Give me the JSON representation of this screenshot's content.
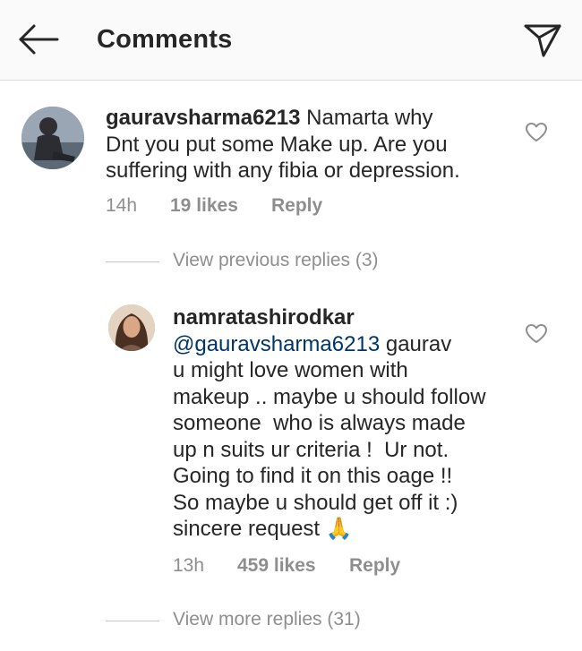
{
  "header": {
    "title": "Comments"
  },
  "comments": [
    {
      "username": "gauravsharma6213",
      "lines": [
        " Namarta why",
        "Dnt you put some Make up. Are you",
        "suffering with any fibia or depression."
      ],
      "time": "14h",
      "likes": "19 likes",
      "reply_label": "Reply"
    },
    {
      "username": "namratashirodkar",
      "mention": "@gauravsharma6213",
      "lines": [
        " gaurav",
        "u might love women with",
        "makeup .. maybe u should follow",
        "someone  who is always made",
        "up n suits ur criteria !  Ur not.",
        "Going to find it on this oage !!",
        "So maybe u should get off it :)",
        "sincere request "
      ],
      "emoji": "🙏",
      "time": "13h",
      "likes": "459 likes",
      "reply_label": "Reply"
    }
  ],
  "replies_toggles": {
    "previous": "View previous replies (3)",
    "more": "View more replies (31)"
  },
  "colors": {
    "text": "#262626",
    "secondary": "#8e8e8e",
    "mention": "#003569",
    "divider": "#dbdbdb"
  },
  "icons": [
    "back-arrow-icon",
    "send-icon",
    "heart-icon",
    "folded-hands-emoji"
  ]
}
